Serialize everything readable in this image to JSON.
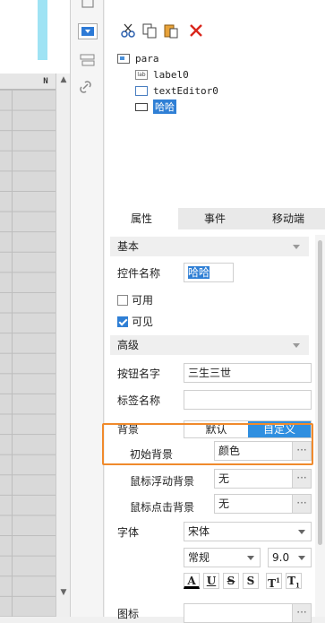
{
  "grid": {
    "column_label": "N"
  },
  "tree": {
    "root": "para",
    "label_icon_text": "lab",
    "children": [
      "label0",
      "textEditor0",
      "哈哈"
    ]
  },
  "tabs": [
    "属性",
    "事件",
    "移动端"
  ],
  "sections": {
    "basic": "基本",
    "advanced": "高级"
  },
  "props": {
    "control_name_label": "控件名称",
    "control_name_value": "哈哈",
    "usable_label": "可用",
    "visible_label": "可见",
    "button_name_label": "按钮名字",
    "button_name_value": "三生三世",
    "tag_name_label": "标签名称",
    "tag_name_value": "",
    "background_label": "背景",
    "bg_default": "默认",
    "bg_custom": "自定义",
    "initial_bg_label": "初始背景",
    "initial_bg_value": "颜色",
    "hover_bg_label": "鼠标浮动背景",
    "hover_bg_value": "无",
    "click_bg_label": "鼠标点击背景",
    "click_bg_value": "无",
    "font_label": "字体",
    "font_value": "宋体",
    "font_style_value": "常规",
    "font_size_value": "9.0",
    "icon_label": "图标",
    "dots": "···",
    "fmt_a": "A",
    "fmt_u": "U",
    "fmt_s1": "S",
    "fmt_s2": "S",
    "fmt_t1": "T",
    "fmt_t2": "T"
  },
  "colors": {
    "accent": "#2f8fe0",
    "highlight": "#f08a2c"
  }
}
